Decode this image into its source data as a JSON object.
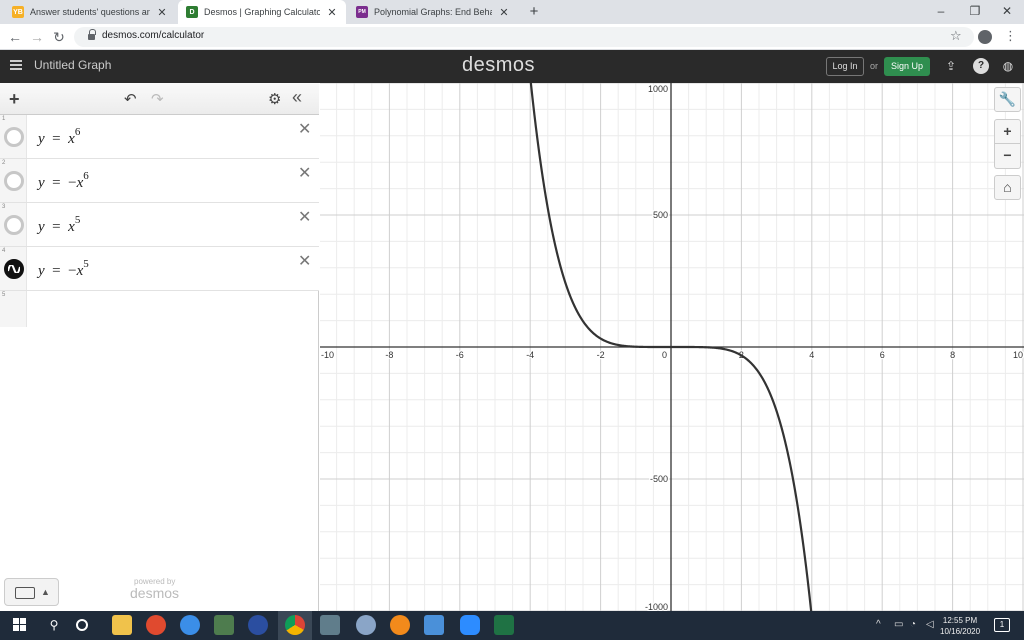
{
  "browser": {
    "tabs": [
      {
        "title": "Answer students' questions and",
        "favicon_color": "#f6b026",
        "favicon_text": "YB"
      },
      {
        "title": "Desmos | Graphing Calculator",
        "favicon_color": "#2e7d32",
        "favicon_text": "D"
      },
      {
        "title": "Polynomial Graphs: End Behavior",
        "favicon_color": "#7b2d8e",
        "favicon_text": "PM"
      }
    ],
    "active_tab": 1,
    "url": "desmos.com/calculator"
  },
  "header": {
    "graph_title": "Untitled Graph",
    "logo": "desmos",
    "login_label": "Log In",
    "or_label": "or",
    "signup_label": "Sign Up"
  },
  "expressions": [
    {
      "index": "1",
      "lhs": "y",
      "rhs": "x",
      "sign": "",
      "exp": "6",
      "hidden": true
    },
    {
      "index": "2",
      "lhs": "y",
      "rhs": "x",
      "sign": "−",
      "exp": "6",
      "hidden": true
    },
    {
      "index": "3",
      "lhs": "y",
      "rhs": "x",
      "sign": "",
      "exp": "5",
      "hidden": true
    },
    {
      "index": "4",
      "lhs": "y",
      "rhs": "x",
      "sign": "−",
      "exp": "5",
      "hidden": false
    }
  ],
  "blank_index": "5",
  "powered_by": "powered by",
  "powered_logo": "desmos",
  "graph": {
    "x_ticks": [
      "-10",
      "-8",
      "-6",
      "-4",
      "-2",
      "0",
      "2",
      "4",
      "6",
      "8",
      "10"
    ],
    "y_ticks": [
      "1000",
      "500",
      "-500",
      "-1000"
    ],
    "x_range": [
      -10,
      10
    ],
    "y_range": [
      -1000,
      1000
    ],
    "curve_color": "#333333",
    "plotted_function": "y = -x^5"
  },
  "taskbar": {
    "time": "12:55 PM",
    "date": "10/16/2020",
    "notification_count": "1"
  }
}
